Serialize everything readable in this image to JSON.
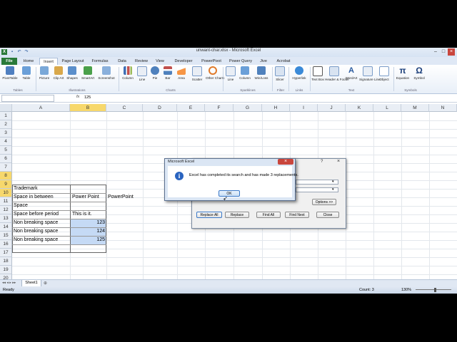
{
  "window": {
    "title": "unwant-char.xlsx - Microsoft Excel"
  },
  "tabs": [
    "File",
    "Home",
    "Insert",
    "Page Layout",
    "Formulas",
    "Data",
    "Review",
    "View",
    "Developer",
    "PowerPivot",
    "Power Query",
    "Jive",
    "Acrobat"
  ],
  "ribbon": {
    "buttons": [
      "PivotTable",
      "Table",
      "Picture",
      "Clip Art",
      "Shapes",
      "SmartArt",
      "Screenshot",
      "Column",
      "Line",
      "Pie",
      "Bar",
      "Area",
      "Scatter",
      "Other Charts",
      "Line",
      "Column",
      "Win/Loss",
      "Slicer",
      "Hyperlink",
      "Text Box",
      "Header & Footer",
      "WordArt",
      "Signature Line",
      "Object",
      "Equation",
      "Symbol"
    ],
    "groups": [
      "Tables",
      "Illustrations",
      "Charts",
      "Sparklines",
      "Filter",
      "Links",
      "Text",
      "Symbols"
    ]
  },
  "formula_bar": {
    "name_box": "",
    "fx": "fx",
    "value": "125"
  },
  "grid": {
    "columns": [
      "A",
      "B",
      "C",
      "D",
      "E",
      "F",
      "G",
      "H",
      "I",
      "J",
      "K",
      "L",
      "M",
      "N"
    ],
    "rows": [
      "1",
      "2",
      "3",
      "4",
      "5",
      "6",
      "7",
      "8",
      "9",
      "10",
      "11",
      "12",
      "13",
      "14",
      "15",
      "16",
      "17",
      "18",
      "19",
      "20"
    ],
    "cells": {
      "a4": "Trademark",
      "a5": "Space in between",
      "b5": "Power Point",
      "c5": "PowerPoint",
      "a6": "Space",
      "a7": "Space before period",
      "b7": "This is it.",
      "a8": "Non breaking space",
      "b8": "123",
      "a9": "Non breaking space",
      "b9": "124",
      "a10": "Non breaking space",
      "b10": "125"
    }
  },
  "sheet_tab": "Sheet1",
  "status": {
    "ready": "Ready",
    "count": "Count: 3",
    "zoom": "130%"
  },
  "find_dialog": {
    "buttons": {
      "replace_all": "Replace All",
      "replace": "Replace",
      "find_all": "Find All",
      "find_next": "Find Next",
      "close": "Close",
      "options": "Options >>"
    }
  },
  "message_box": {
    "title": "Microsoft Excel",
    "message": "Excel has completed its search and has made 3 replacements.",
    "ok": "OK"
  },
  "colors": {
    "file_tab": "#2a7a3a",
    "selection": "#c5daf5",
    "header_highlight": "#f7d86c"
  }
}
